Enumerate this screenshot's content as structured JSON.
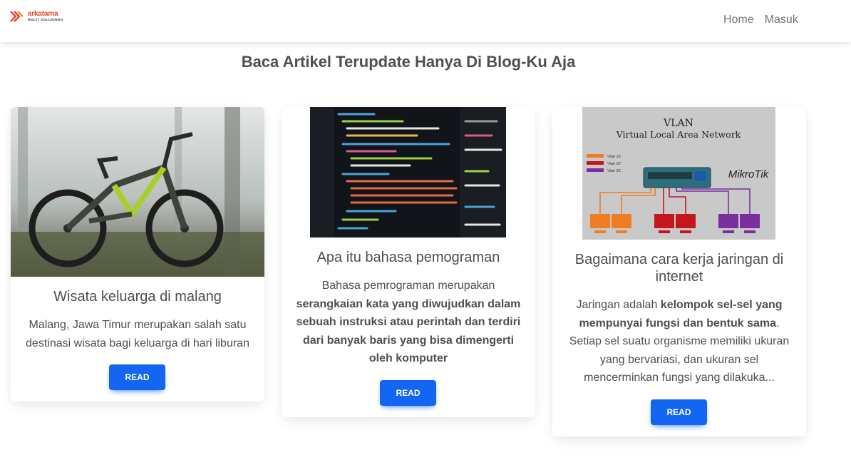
{
  "brand": {
    "name": "arkatama",
    "tagline": "MULTI SOLUSINDO",
    "accent_color": "#e8452b"
  },
  "nav": {
    "items": [
      {
        "label": "Home"
      },
      {
        "label": "Masuk"
      }
    ]
  },
  "page": {
    "heading": "Baca Artikel Terupdate Hanya Di Blog-Ku Aja"
  },
  "articles": [
    {
      "image": "mountain-bike-in-forest",
      "title": "Wisata keluarga di malang",
      "text": "Malang, Jawa Timur merupakan salah satu destinasi wisata bagi keluarga di hari liburan",
      "button": "READ"
    },
    {
      "image": "html-code-on-screen",
      "title": "Apa itu bahasa pemograman",
      "text_intro": "Bahasa pemrograman merupakan",
      "text_bold": "serangkaian kata yang diwujudkan dalam sebuah instruksi atau perintah dan terdiri dari banyak baris yang bisa dimengerti oleh komputer",
      "button": "READ"
    },
    {
      "image": "vlan-network-diagram",
      "image_title": "VLAN",
      "image_subtitle": "Virtual Local Area Network",
      "image_brand": "MikroTik",
      "image_legend": [
        "Vlan 10",
        "Vlan 20",
        "Vlan 30"
      ],
      "title": "Bagaimana cara kerja jaringan di internet",
      "text_intro": "Jaringan adalah",
      "text_bold": "kelompok sel-sel yang mempunyai fungsi dan bentuk sama",
      "text_rest": ". Setiap sel suatu organisme memiliki ukuran yang bervariasi, dan ukuran sel mencerminkan fungsi yang dilakuka...",
      "button": "READ"
    }
  ],
  "colors": {
    "primary_button": "#1266f1",
    "text": "#4f4f4f",
    "nav_text": "#757575"
  }
}
